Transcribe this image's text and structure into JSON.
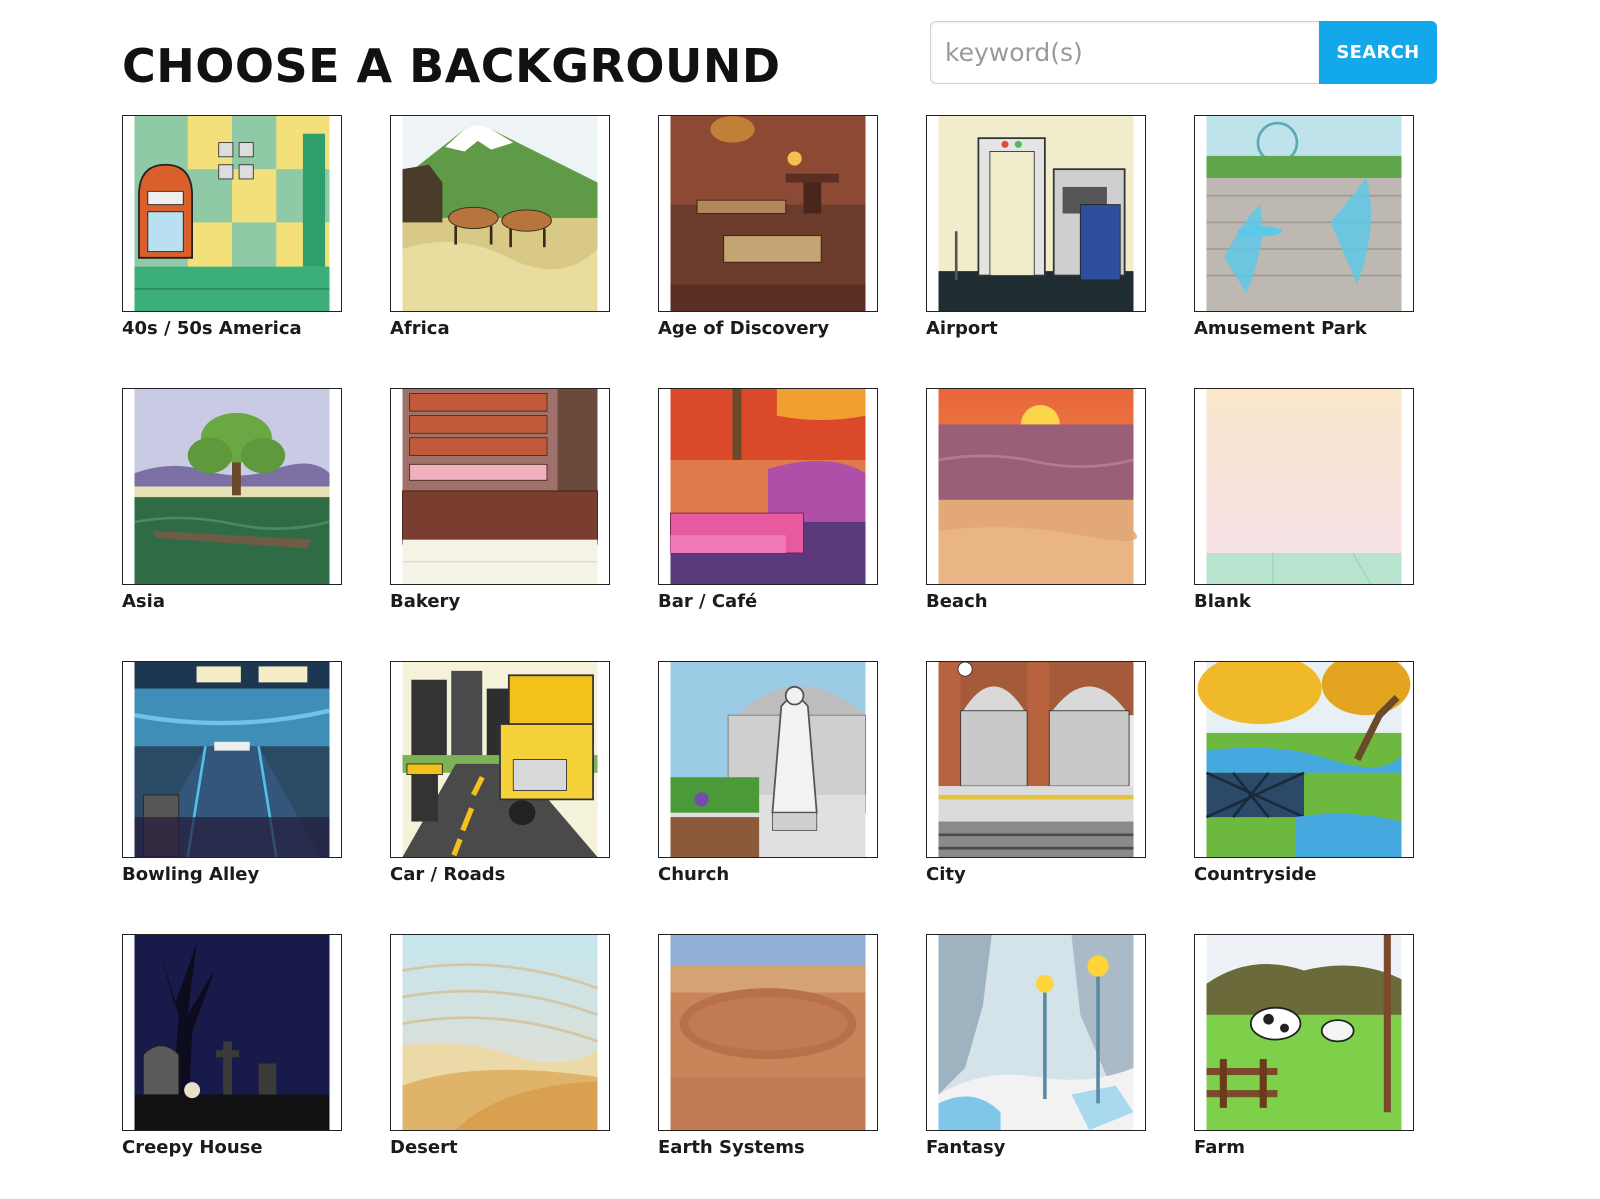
{
  "header": {
    "title": "CHOOSE A BACKGROUND"
  },
  "search": {
    "placeholder": "keyword(s)",
    "value": "",
    "button_label": "SEARCH"
  },
  "backgrounds": [
    {
      "label": "40s / 50s America",
      "icon": "jukebox-room-thumbnail"
    },
    {
      "label": "Africa",
      "icon": "savanna-antelope-thumbnail"
    },
    {
      "label": "Age of Discovery",
      "icon": "ship-cabin-thumbnail"
    },
    {
      "label": "Airport",
      "icon": "airport-security-thumbnail"
    },
    {
      "label": "Amusement Park",
      "icon": "amusement-park-thumbnail"
    },
    {
      "label": "Asia",
      "icon": "willow-river-thumbnail"
    },
    {
      "label": "Bakery",
      "icon": "bakery-shelves-thumbnail"
    },
    {
      "label": "Bar / Café",
      "icon": "bar-stage-thumbnail"
    },
    {
      "label": "Beach",
      "icon": "sunset-beach-thumbnail"
    },
    {
      "label": "Blank",
      "icon": "blank-room-thumbnail"
    },
    {
      "label": "Bowling Alley",
      "icon": "bowling-lanes-thumbnail"
    },
    {
      "label": "Car / Roads",
      "icon": "truck-road-thumbnail"
    },
    {
      "label": "Church",
      "icon": "church-statue-thumbnail"
    },
    {
      "label": "City",
      "icon": "city-station-thumbnail"
    },
    {
      "label": "Countryside",
      "icon": "countryside-bridge-thumbnail"
    },
    {
      "label": "Creepy House",
      "icon": "graveyard-night-thumbnail"
    },
    {
      "label": "Desert",
      "icon": "sand-dunes-thumbnail"
    },
    {
      "label": "Earth Systems",
      "icon": "earth-layers-thumbnail"
    },
    {
      "label": "Fantasy",
      "icon": "ice-cave-lamps-thumbnail"
    },
    {
      "label": "Farm",
      "icon": "farm-cow-thumbnail"
    }
  ],
  "colors": {
    "accent": "#13a8ec",
    "title": "#111111"
  }
}
